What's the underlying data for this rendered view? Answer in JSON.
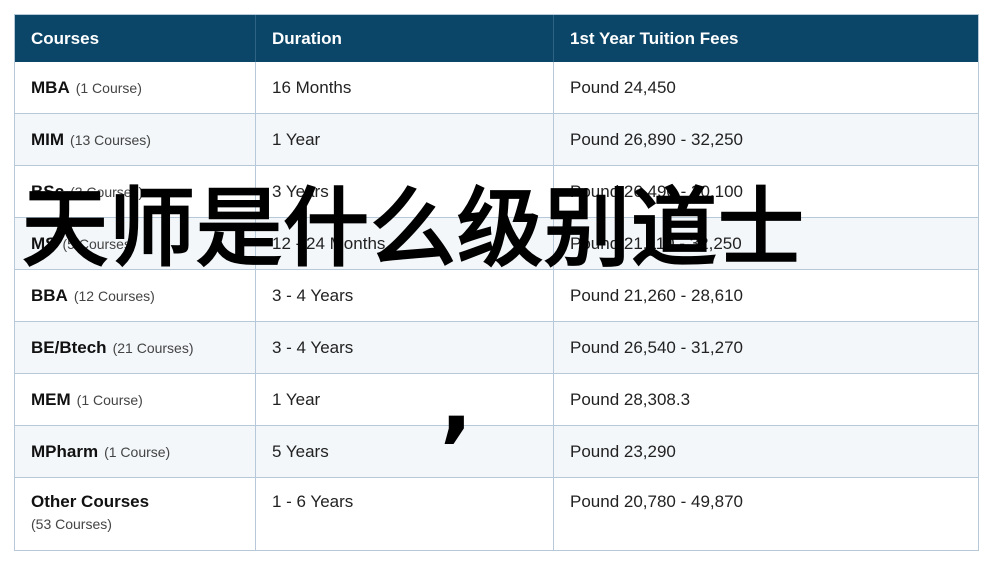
{
  "table": {
    "headers": [
      "Courses",
      "Duration",
      "1st Year Tuition Fees"
    ],
    "rows": [
      {
        "course": "MBA",
        "count": "(1 Course)",
        "duration": "16 Months",
        "fees": "Pound 24,450"
      },
      {
        "course": "MIM",
        "count": "(13 Courses)",
        "duration": "1 Year",
        "fees": "Pound 26,890 - 32,250"
      },
      {
        "course": "BSc",
        "count": "(3 Courses)",
        "duration": "3 Years",
        "fees": "Pound 26,490 - 30,100"
      },
      {
        "course": "MS",
        "count": "(5 Courses)",
        "duration": "12 - 24 Months",
        "fees": "Pound 21,110 - 32,250"
      },
      {
        "course": "BBA",
        "count": "(12 Courses)",
        "duration": "3 - 4 Years",
        "fees": "Pound 21,260 - 28,610"
      },
      {
        "course": "BE/Btech",
        "count": "(21 Courses)",
        "duration": "3 - 4 Years",
        "fees": "Pound 26,540 - 31,270"
      },
      {
        "course": "MEM",
        "count": "(1 Course)",
        "duration": "1 Year",
        "fees": "Pound 28,308.3"
      },
      {
        "course": "MPharm",
        "count": "(1 Course)",
        "duration": "5 Years",
        "fees": "Pound 23,290"
      },
      {
        "course": "Other Courses",
        "count": "(53 Courses)",
        "duration": "1 - 6 Years",
        "fees": "Pound 20,780 - 49,870"
      }
    ]
  },
  "overlay": {
    "title": "天师是什么级别道士",
    "comma": ","
  },
  "colors": {
    "header_bg": "#0b4669",
    "header_text": "#ffffff",
    "border": "#b7c9d8",
    "row_alt": "#f3f7fa"
  }
}
